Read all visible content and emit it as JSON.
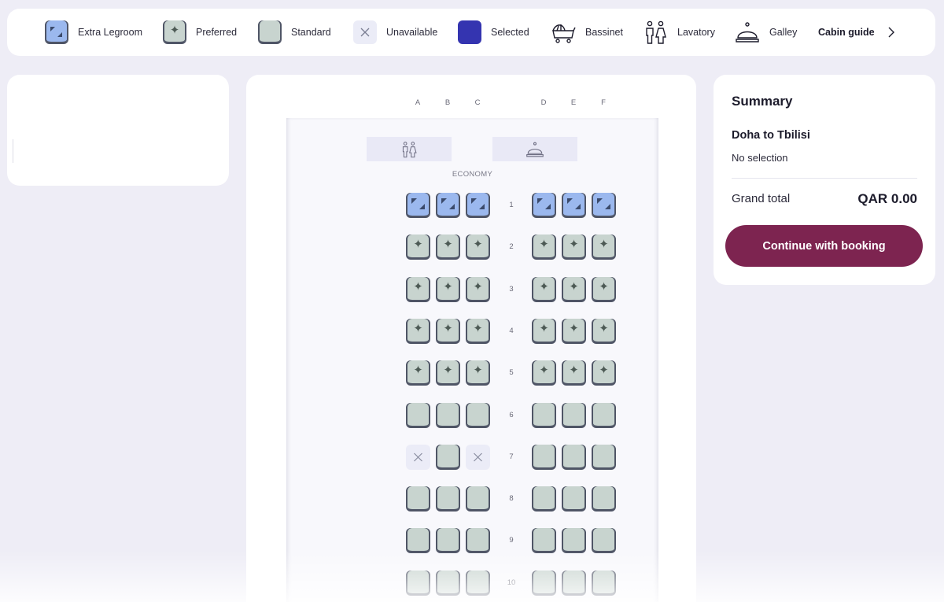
{
  "legend": {
    "items": [
      {
        "key": "extra_legroom",
        "label": "Extra Legroom",
        "icon": "extra-legroom-seat-icon"
      },
      {
        "key": "preferred",
        "label": "Preferred",
        "icon": "preferred-seat-icon"
      },
      {
        "key": "standard",
        "label": "Standard",
        "icon": "standard-seat-icon"
      },
      {
        "key": "unavailable",
        "label": "Unavailable",
        "icon": "unavailable-seat-icon"
      },
      {
        "key": "selected",
        "label": "Selected",
        "icon": "selected-seat-icon"
      },
      {
        "key": "bassinet",
        "label": "Bassinet",
        "icon": "bassinet-icon"
      },
      {
        "key": "lavatory",
        "label": "Lavatory",
        "icon": "lavatory-icon"
      },
      {
        "key": "galley",
        "label": "Galley",
        "icon": "galley-icon"
      }
    ],
    "cabin_guide_label": "Cabin guide"
  },
  "seat_map": {
    "columns_left": [
      "A",
      "B",
      "C"
    ],
    "columns_right": [
      "D",
      "E",
      "F"
    ],
    "cabin_label": "ECONOMY",
    "facilities": [
      "lavatory",
      "galley"
    ],
    "rows": [
      {
        "number": "1",
        "seats": [
          "legroom",
          "legroom",
          "legroom",
          "legroom",
          "legroom",
          "legroom"
        ]
      },
      {
        "number": "2",
        "seats": [
          "preferred",
          "preferred",
          "preferred",
          "preferred",
          "preferred",
          "preferred"
        ]
      },
      {
        "number": "3",
        "seats": [
          "preferred",
          "preferred",
          "preferred",
          "preferred",
          "preferred",
          "preferred"
        ]
      },
      {
        "number": "4",
        "seats": [
          "preferred",
          "preferred",
          "preferred",
          "preferred",
          "preferred",
          "preferred"
        ]
      },
      {
        "number": "5",
        "seats": [
          "preferred",
          "preferred",
          "preferred",
          "preferred",
          "preferred",
          "preferred"
        ]
      },
      {
        "number": "6",
        "seats": [
          "standard",
          "standard",
          "standard",
          "standard",
          "standard",
          "standard"
        ]
      },
      {
        "number": "7",
        "seats": [
          "unavailable",
          "standard",
          "unavailable",
          "standard",
          "standard",
          "standard"
        ]
      },
      {
        "number": "8",
        "seats": [
          "standard",
          "standard",
          "standard",
          "standard",
          "standard",
          "standard"
        ]
      },
      {
        "number": "9",
        "seats": [
          "standard",
          "standard",
          "standard",
          "standard",
          "standard",
          "standard"
        ]
      },
      {
        "number": "10",
        "seats": [
          "standard",
          "standard",
          "standard",
          "standard",
          "standard",
          "standard"
        ]
      }
    ]
  },
  "summary": {
    "title": "Summary",
    "route": "Doha to Tbilisi",
    "selection_status": "No selection",
    "grand_total_label": "Grand total",
    "grand_total_value": "QAR 0.00",
    "continue_label": "Continue with booking"
  },
  "colors": {
    "legroom": "#9bb8ee",
    "preferred": "#c8d4cf",
    "standard": "#c8d4cf",
    "unavailable": "#ebecf7",
    "selected": "#3434b0",
    "cta": "#7d2450"
  }
}
